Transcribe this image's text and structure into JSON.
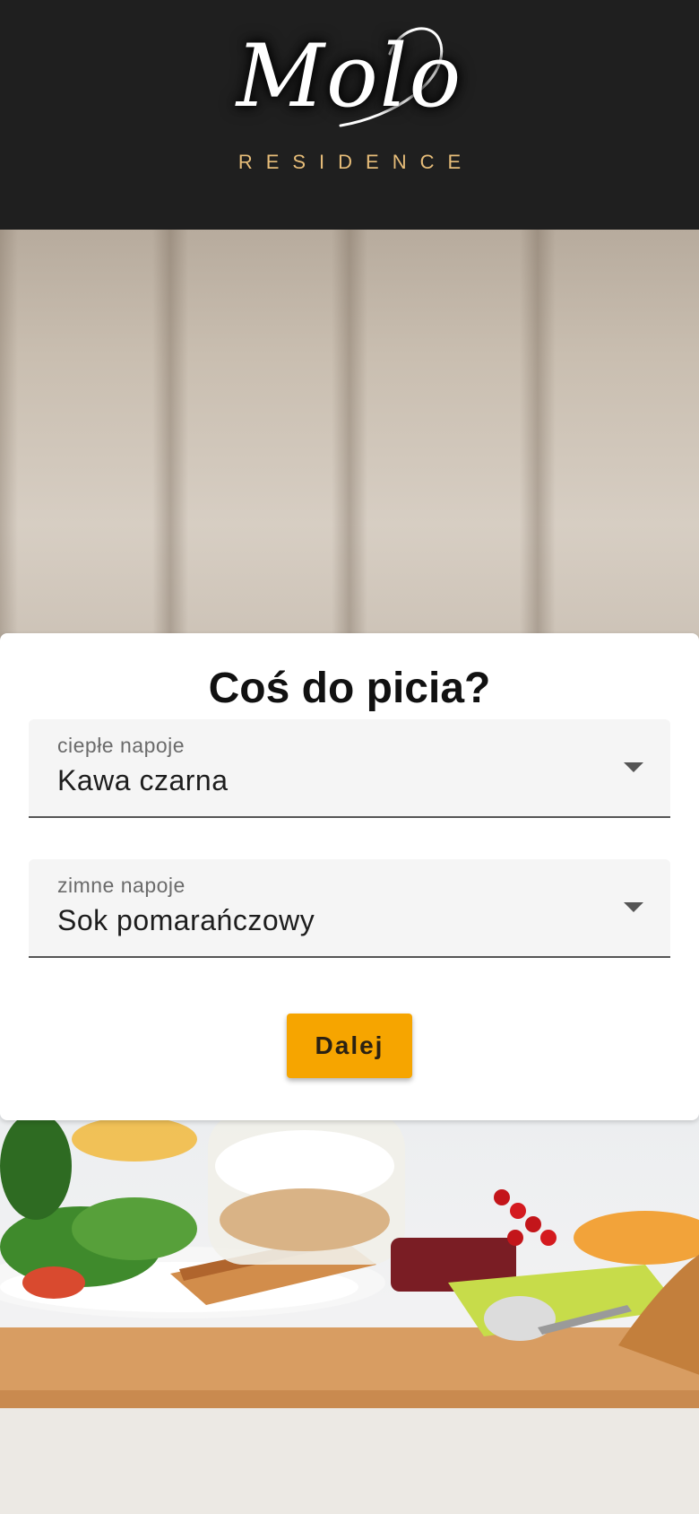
{
  "brand": {
    "script": "Molo",
    "subtitle": "RESIDENCE"
  },
  "question": {
    "title": "Coś do picia?"
  },
  "hot_drinks": {
    "label": "ciepłe napoje",
    "value": "Kawa czarna"
  },
  "cold_drinks": {
    "label": "zimne napoje",
    "value": "Sok pomarańczowy"
  },
  "actions": {
    "next_label": "Dalej"
  },
  "colors": {
    "header_bg": "#1f1f1f",
    "accent": "#f6a500",
    "logo_gold": "#e7bd79"
  },
  "icons": {
    "dropdown": "caret-down-icon"
  }
}
